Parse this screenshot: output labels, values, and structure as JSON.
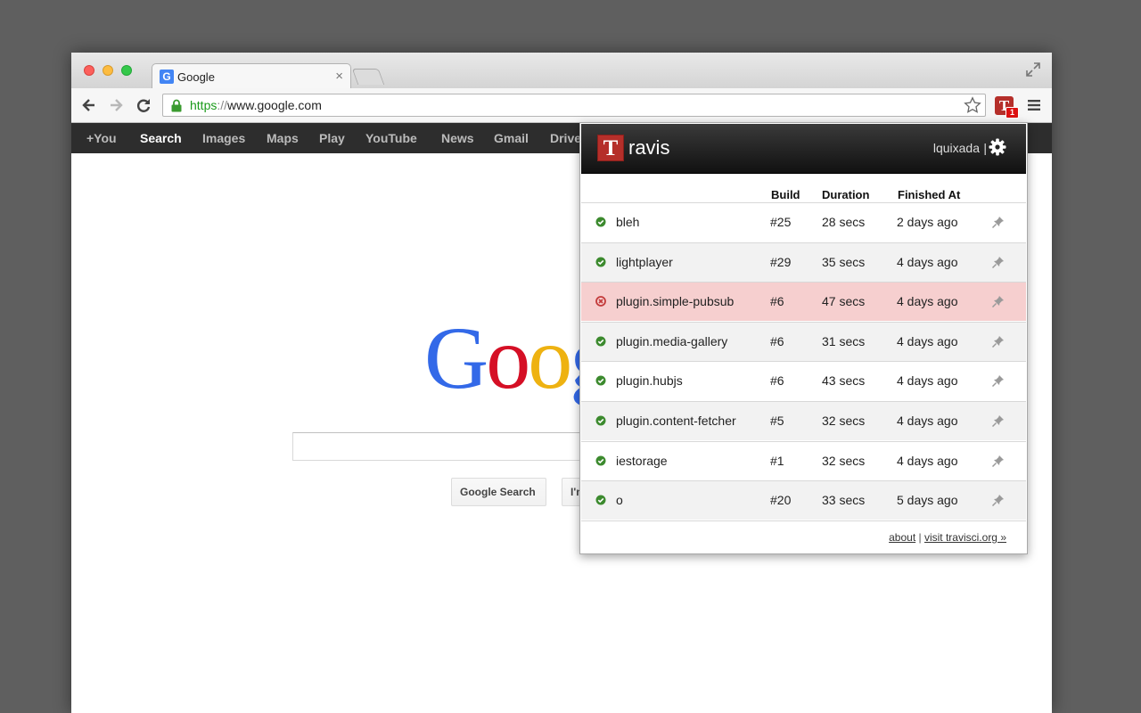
{
  "browser": {
    "tab_title": "Google",
    "tab_favicon": "G",
    "tab_close": "×",
    "url_scheme": "https",
    "url_sep": "://",
    "url_rest": "www.google.com",
    "extension_letter": "T",
    "extension_badge": "1"
  },
  "gbar": {
    "items": [
      "+You",
      "Search",
      "Images",
      "Maps",
      "Play",
      "YouTube",
      "News",
      "Gmail",
      "Drive"
    ],
    "active": "Search"
  },
  "google": {
    "logo": "Goog",
    "search_button": "Google Search",
    "lucky_button": "I'm Feeling Lucky"
  },
  "travis": {
    "logo_letter": "T",
    "logo_text": "ravis",
    "username": "lquixada",
    "user_separator": "|",
    "columns": {
      "build": "Build",
      "duration": "Duration",
      "finished": "Finished At"
    },
    "builds": [
      {
        "name": "bleh",
        "build": "#25",
        "duration": "28 secs",
        "finished": "2 days ago",
        "status": "passed"
      },
      {
        "name": "lightplayer",
        "build": "#29",
        "duration": "35 secs",
        "finished": "4 days ago",
        "status": "passed"
      },
      {
        "name": "plugin.simple-pubsub",
        "build": "#6",
        "duration": "47 secs",
        "finished": "4 days ago",
        "status": "failed"
      },
      {
        "name": "plugin.media-gallery",
        "build": "#6",
        "duration": "31 secs",
        "finished": "4 days ago",
        "status": "passed"
      },
      {
        "name": "plugin.hubjs",
        "build": "#6",
        "duration": "43 secs",
        "finished": "4 days ago",
        "status": "passed"
      },
      {
        "name": "plugin.content-fetcher",
        "build": "#5",
        "duration": "32 secs",
        "finished": "4 days ago",
        "status": "passed"
      },
      {
        "name": "iestorage",
        "build": "#1",
        "duration": "32 secs",
        "finished": "4 days ago",
        "status": "passed"
      },
      {
        "name": "o",
        "build": "#20",
        "duration": "33 secs",
        "finished": "5 days ago",
        "status": "passed"
      }
    ],
    "footer": {
      "about": "about",
      "separator": "|",
      "visit": "visit travisci.org »"
    }
  },
  "colors": {
    "passed": "#3c8a2e",
    "failed": "#c33b3b",
    "travis_red": "#b52f2a",
    "failed_row": "#f6cfcf"
  },
  "icons": {
    "status_passed": "check-circle-icon",
    "status_failed": "x-circle-icon",
    "pin": "pin-icon",
    "settings": "gear-icon"
  }
}
